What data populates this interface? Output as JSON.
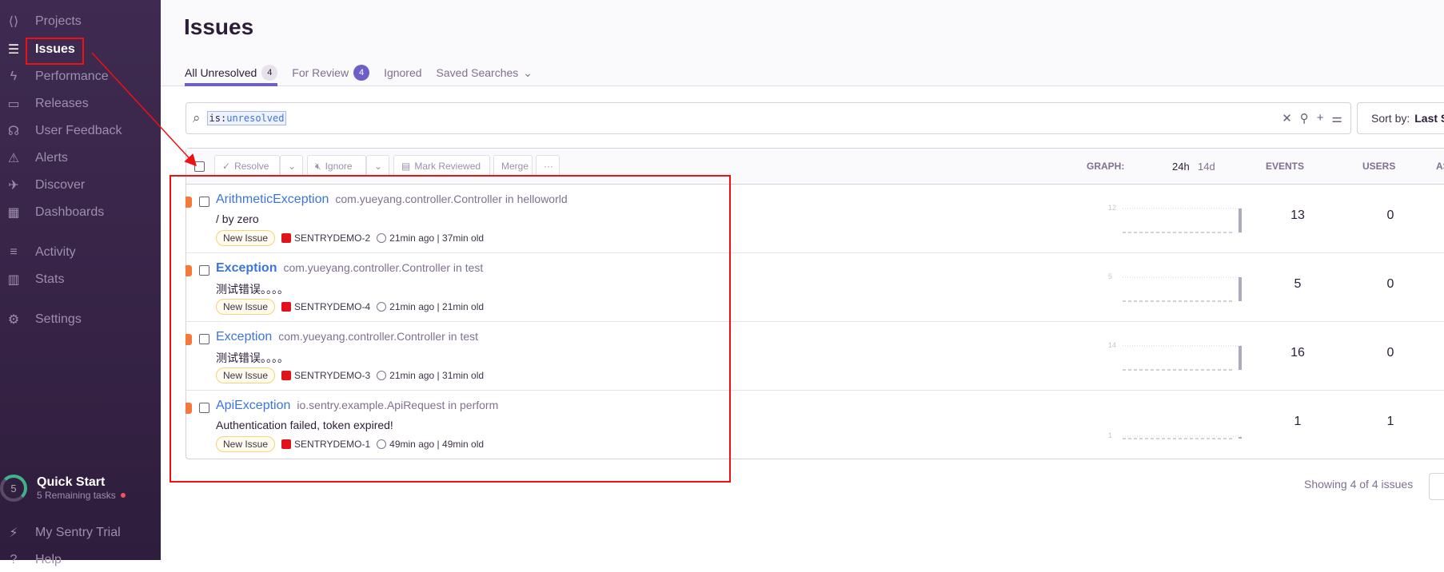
{
  "sidebar": {
    "items": [
      {
        "label": "Projects",
        "icon": "projects-icon"
      },
      {
        "label": "Issues",
        "icon": "issues-icon",
        "active": true
      },
      {
        "label": "Performance",
        "icon": "lightning-icon"
      },
      {
        "label": "Releases",
        "icon": "releases-icon"
      },
      {
        "label": "User Feedback",
        "icon": "headset-icon"
      },
      {
        "label": "Alerts",
        "icon": "siren-icon"
      },
      {
        "label": "Discover",
        "icon": "telescope-icon"
      },
      {
        "label": "Dashboards",
        "icon": "dashboard-icon"
      },
      {
        "label": "Activity",
        "icon": "list-icon"
      },
      {
        "label": "Stats",
        "icon": "stats-icon"
      },
      {
        "label": "Settings",
        "icon": "gear-icon"
      },
      {
        "label": "My Sentry Trial",
        "icon": "lightning-circle-icon"
      },
      {
        "label": "Help",
        "icon": "help-icon"
      }
    ],
    "quick_start": {
      "count": "5",
      "title": "Quick Start",
      "subtitle": "5 Remaining tasks"
    }
  },
  "header": {
    "title": "Issues",
    "tabs": [
      {
        "label": "All Unresolved",
        "badge": "4"
      },
      {
        "label": "For Review",
        "badge": "4"
      },
      {
        "label": "Ignored"
      },
      {
        "label": "Saved Searches"
      }
    ]
  },
  "search": {
    "key": "is:",
    "value": "unresolved"
  },
  "sort": {
    "label": "Sort by:",
    "value": "Last S"
  },
  "toolbar": {
    "resolve": "Resolve",
    "ignore": "Ignore",
    "mark_reviewed": "Mark Reviewed",
    "merge": "Merge",
    "more": "···"
  },
  "columns": {
    "graph": "GRAPH:",
    "h24": "24h",
    "d14": "14d",
    "events": "EVENTS",
    "users": "USERS",
    "assignee": "AS"
  },
  "issues": [
    {
      "type": "ArithmeticException",
      "location": "com.yueyang.controller.Controller in helloworld",
      "message": "/ by zero",
      "status": "New Issue",
      "project": "SENTRYDEMO-2",
      "last_seen": "21min ago",
      "age": "37min old",
      "graph_max": "12",
      "events": "13",
      "users": "0"
    },
    {
      "type": "Exception",
      "location": "com.yueyang.controller.Controller in test",
      "message": "测试错误。。。。",
      "status": "New Issue",
      "project": "SENTRYDEMO-4",
      "last_seen": "21min ago",
      "age": "21min old",
      "graph_max": "5",
      "events": "5",
      "users": "0"
    },
    {
      "type": "Exception",
      "location": "com.yueyang.controller.Controller in test",
      "message": "测试错误。。。。",
      "status": "New Issue",
      "project": "SENTRYDEMO-3",
      "last_seen": "21min ago",
      "age": "31min old",
      "graph_max": "14",
      "events": "16",
      "users": "0"
    },
    {
      "type": "ApiException",
      "location": "io.sentry.example.ApiRequest in perform",
      "message": "Authentication failed, token expired!",
      "status": "New Issue",
      "project": "SENTRYDEMO-1",
      "last_seen": "49min ago",
      "age": "49min old",
      "graph_max": "1",
      "events": "1",
      "users": "1"
    }
  ],
  "footer": {
    "text": "Showing 4 of 4 issues"
  },
  "colors": {
    "sidebar": "#3f2b51",
    "accent": "#6c5fc7",
    "link": "#3d74db",
    "level_error": "#f5793b",
    "annotation": "#ee1111"
  }
}
